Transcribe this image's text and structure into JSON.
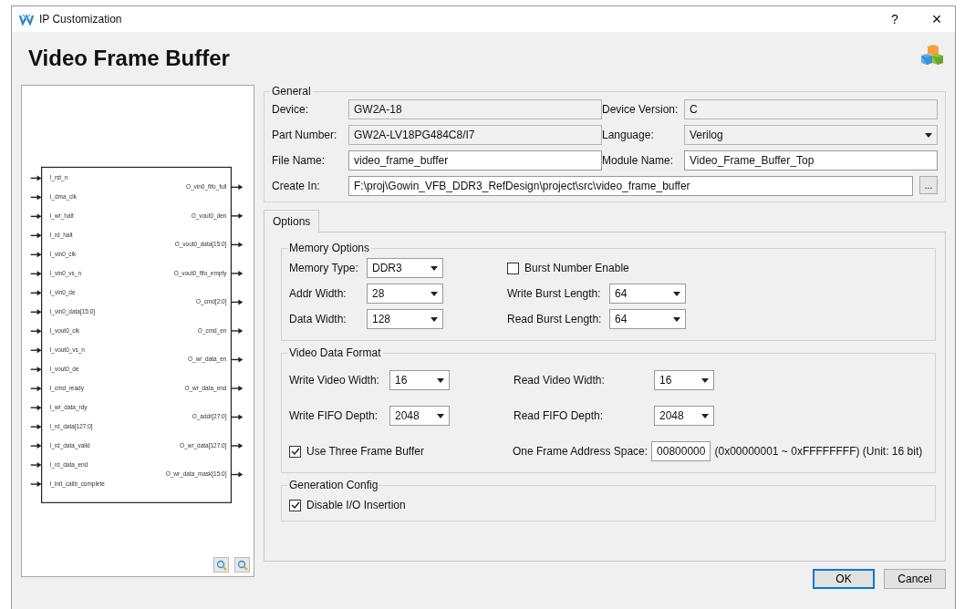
{
  "window": {
    "title": "IP Customization",
    "help": "?",
    "close": "×"
  },
  "heading": "Video Frame Buffer",
  "diagram": {
    "inputs": [
      "I_rst_n",
      "I_dma_clk",
      "I_wr_halt",
      "I_rd_halt",
      "I_vin0_clk",
      "I_vin0_vs_n",
      "I_vin0_de",
      "I_vin0_data[15:0]",
      "I_vout0_clk",
      "I_vout0_vs_n",
      "I_vout0_de",
      "I_cmd_ready",
      "I_wr_data_rdy",
      "I_rd_data[127:0]",
      "I_rd_data_valid",
      "I_rd_data_end",
      "I_init_calib_complete"
    ],
    "outputs": [
      "O_vin0_fifo_full",
      "O_vout0_den",
      "O_vout0_data[15:0]",
      "O_vout0_fifo_empty",
      "O_cmd[2:0]",
      "O_cmd_en",
      "O_wr_data_en",
      "O_wr_data_end",
      "O_addr[27:0]",
      "O_wr_data[127:0]",
      "O_wr_data_mask[15:0]"
    ]
  },
  "general": {
    "title": "General",
    "rows": [
      [
        {
          "label": "Device:",
          "value": "GW2A-18",
          "kind": "readonly"
        },
        {
          "label": "Device Version:",
          "value": "C",
          "kind": "readonly"
        }
      ],
      [
        {
          "label": "Part Number:",
          "value": "GW2A-LV18PG484C8/I7",
          "kind": "readonly"
        },
        {
          "label": "Language:",
          "value": "Verilog",
          "kind": "combo"
        }
      ],
      [
        {
          "label": "File Name:",
          "value": "video_frame_buffer",
          "kind": "text"
        },
        {
          "label": "Module Name:",
          "value": "Video_Frame_Buffer_Top",
          "kind": "text"
        }
      ]
    ],
    "create_in": {
      "label": "Create In:",
      "value": "F:\\proj\\Gowin_VFB_DDR3_RefDesign\\project\\src\\video_frame_buffer",
      "browse": "..."
    }
  },
  "tabs": [
    {
      "label": "Options",
      "selected": true
    }
  ],
  "memory_options": {
    "title": "Memory Options",
    "rows": [
      [
        {
          "kind": "select",
          "label": "Memory Type:",
          "value": "DDR3"
        },
        {
          "kind": "checkbox",
          "label": "Burst Number Enable",
          "checked": false
        }
      ],
      [
        {
          "kind": "select",
          "label": "Addr Width:",
          "value": "28"
        },
        {
          "kind": "select",
          "label": "Write Burst Length:",
          "value": "64"
        }
      ],
      [
        {
          "kind": "select",
          "label": "Data Width:",
          "value": "128"
        },
        {
          "kind": "select",
          "label": "Read Burst Length:",
          "value": "64"
        }
      ]
    ]
  },
  "video_data_format": {
    "title": "Video Data Format",
    "rows": [
      [
        {
          "label": "Write Video Width:",
          "value": "16"
        },
        {
          "label": "Read Video Width:",
          "value": "16"
        }
      ],
      [
        {
          "label": "Write FIFO Depth:",
          "value": "2048"
        },
        {
          "label": "Read FIFO Depth:",
          "value": "2048"
        }
      ]
    ],
    "three_frame": {
      "label": "Use Three Frame Buffer",
      "checked": true
    },
    "address": {
      "label": "One Frame Address Space:",
      "value": "00800000",
      "note": "(0x00000001 ~ 0xFFFFFFFF) (Unit: 16 bit)"
    }
  },
  "generation_config": {
    "title": "Generation Config",
    "checkbox": {
      "label": "Disable I/O Insertion",
      "checked": true
    }
  },
  "buttons": [
    "OK",
    "Cancel"
  ]
}
